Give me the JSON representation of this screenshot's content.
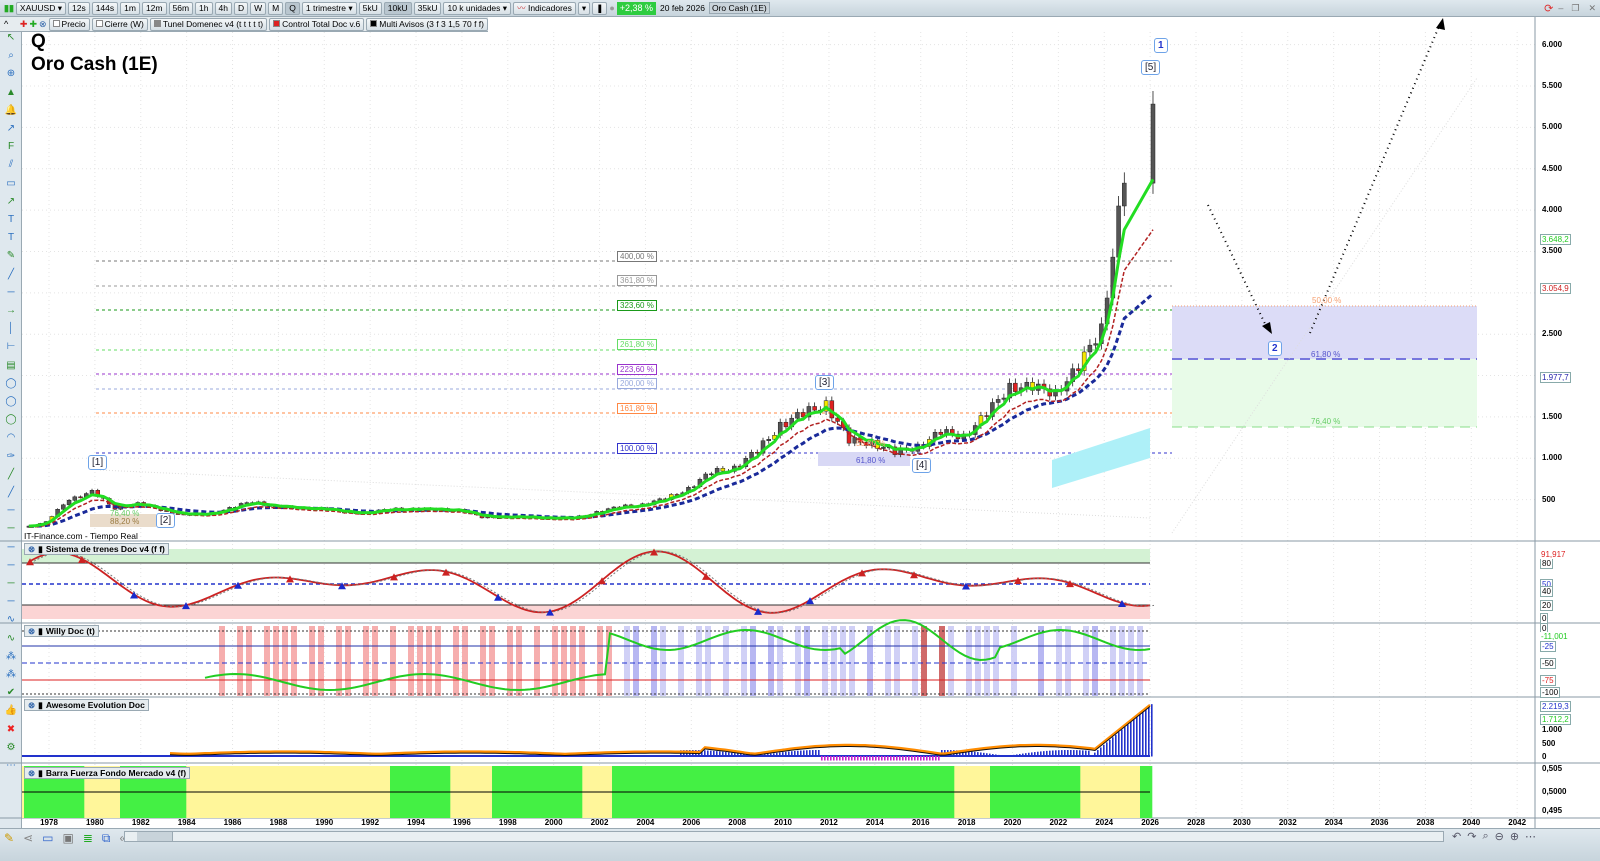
{
  "toolbar": {
    "symbol": "XAUUSD",
    "timeframes": [
      "12s",
      "144s",
      "1m",
      "12m",
      "56m",
      "1h",
      "4h",
      "D",
      "W",
      "M",
      "Q"
    ],
    "active_timeframe": "Q",
    "period": "1 trimestre",
    "units": [
      "5kU",
      "10kU",
      "35kU"
    ],
    "active_unit": "10kU",
    "units_select": "10 k unidades",
    "indicators_label": "Indicadores",
    "change": "+2,38 %",
    "date": "20 feb 2026",
    "chart_name": "Oro Cash (1E)"
  },
  "legend": {
    "items": [
      "Precio",
      "Cierre (W)",
      "Tunel Domenec v4 (t t t t t)",
      "Control Total Doc v.6",
      "Multi Avisos (3 f 3 1,5 70 f f)"
    ]
  },
  "header": {
    "symbol_short": "Q",
    "title": "Oro Cash (1E)"
  },
  "source": "IT-Finance.com - Tiempo Real",
  "colors": {
    "up": "#555555",
    "down": "#e02020",
    "ema_fast": "#22dd22",
    "ema_mid": "#b22222",
    "ema_slow": "#1a2a9a",
    "accent": "#2ecc40"
  },
  "fib_levels": [
    {
      "label": "400,00 %",
      "color": "#777777"
    },
    {
      "label": "361,80 %",
      "color": "#999999"
    },
    {
      "label": "323,60 %",
      "color": "#1a9a1a"
    },
    {
      "label": "261,80 %",
      "color": "#66dd66"
    },
    {
      "label": "223,60 %",
      "color": "#9933cc"
    },
    {
      "label": "200,00 %",
      "color": "#99aadd"
    },
    {
      "label": "161,80 %",
      "color": "#ff8844"
    },
    {
      "label": "100,00 %",
      "color": "#3333cc"
    }
  ],
  "retrace": {
    "r50": "50,00 %",
    "r618": "61,80 %",
    "r764": "76,40 %",
    "r882": "88,20 %"
  },
  "waves": [
    "[1]",
    "[2]",
    "[3]",
    "[4]",
    "[5]",
    "1",
    "2"
  ],
  "main_axis": {
    "ticks": [
      "6.000",
      "5.500",
      "5.000",
      "4.500",
      "4.000",
      "3.500",
      "2.500",
      "1.500",
      "1.000",
      "500"
    ],
    "badges": [
      {
        "label": "3.648,2",
        "color": "#22cc22"
      },
      {
        "label": "3.054,9",
        "color": "#cc2222"
      },
      {
        "label": "1.977,7",
        "color": "#2222aa"
      }
    ]
  },
  "chart_data": {
    "type": "candlestick",
    "timeframe": "quarterly",
    "years": [
      1977,
      1978,
      1979,
      1980,
      1981,
      1982,
      1983,
      1984,
      1985,
      1986,
      1987,
      1988,
      1989,
      1990,
      1991,
      1992,
      1993,
      1994,
      1995,
      1996,
      1997,
      1998,
      1999,
      2000,
      2001,
      2002,
      2003,
      2004,
      2005,
      2006,
      2007,
      2008,
      2009,
      2010,
      2011,
      2012,
      2013,
      2014,
      2015,
      2016,
      2017,
      2018,
      2019,
      2020,
      2021,
      2022,
      2023,
      2024,
      2025,
      2026
    ],
    "closes": [
      165,
      226,
      512,
      590,
      400,
      448,
      382,
      309,
      327,
      391,
      484,
      410,
      401,
      386,
      353,
      333,
      391,
      383,
      387,
      369,
      290,
      288,
      290,
      273,
      279,
      347,
      416,
      438,
      513,
      632,
      834,
      884,
      1087,
      1405,
      1531,
      1664,
      1204,
      1199,
      1060,
      1151,
      1303,
      1281,
      1517,
      1895,
      1829,
      1824,
      2063,
      2625,
      4320,
      5100
    ],
    "ylim": [
      0,
      6200
    ],
    "xlim": [
      1977,
      2043
    ]
  },
  "x_axis": {
    "years": [
      "1978",
      "1980",
      "1982",
      "1984",
      "1986",
      "1988",
      "1990",
      "1992",
      "1994",
      "1996",
      "1998",
      "2000",
      "2002",
      "2004",
      "2006",
      "2008",
      "2010",
      "2012",
      "2014",
      "2016",
      "2018",
      "2020",
      "2022",
      "2024",
      "2026",
      "2028",
      "2030",
      "2032",
      "2034",
      "2036",
      "2038",
      "2040",
      "2042"
    ]
  },
  "panels": [
    {
      "title": "Sistema de trenes Doc v4 (f f)",
      "ticks": [
        "80",
        "50",
        "40",
        "20",
        "0"
      ],
      "badge": "91,917"
    },
    {
      "title": "Willy Doc (t)",
      "ticks": [
        "0",
        "-25",
        "-50",
        "-75",
        "-100"
      ],
      "badge": "-11,001"
    },
    {
      "title": "Awesome Evolution Doc",
      "ticks": [
        "1.000",
        "500",
        "0"
      ],
      "badges": [
        "2.219,3",
        "1.712,2"
      ]
    },
    {
      "title": "Barra Fuerza Fondo Mercado v4 (f)",
      "ticks": [
        "0,505",
        "0,5000",
        "0,495"
      ]
    }
  ]
}
